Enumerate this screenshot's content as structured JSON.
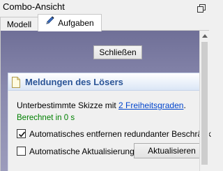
{
  "window": {
    "title": "Combo-Ansicht",
    "restore_icon": "dock-restore-icon"
  },
  "tabs": [
    {
      "label": "Modell",
      "active": false
    },
    {
      "label": "Aufgaben",
      "active": true,
      "icon": "pencil-icon"
    }
  ],
  "panel": {
    "close_label": "Schließen"
  },
  "solver_messages": {
    "title": "Meldungen des Lösers",
    "icon": "document-icon",
    "message_prefix": "Unterbestimmte Skizze mit ",
    "message_link": "2 Freiheitsgraden",
    "message_suffix": ".",
    "computed": "Berechnet in 0 s",
    "auto_remove_label": "Automatisches entfernen redundanter Beschränk",
    "auto_remove_checked": true,
    "auto_update_label": "Automatische Aktualisierung",
    "auto_update_checked": false,
    "update_label": "Aktualisieren"
  },
  "colors": {
    "panel_gradient_top": "#6f6f97",
    "panel_gradient_bottom": "#9c9cbc",
    "group_title": "#2b5597",
    "link": "#0044cc",
    "computed_text": "#008000"
  }
}
